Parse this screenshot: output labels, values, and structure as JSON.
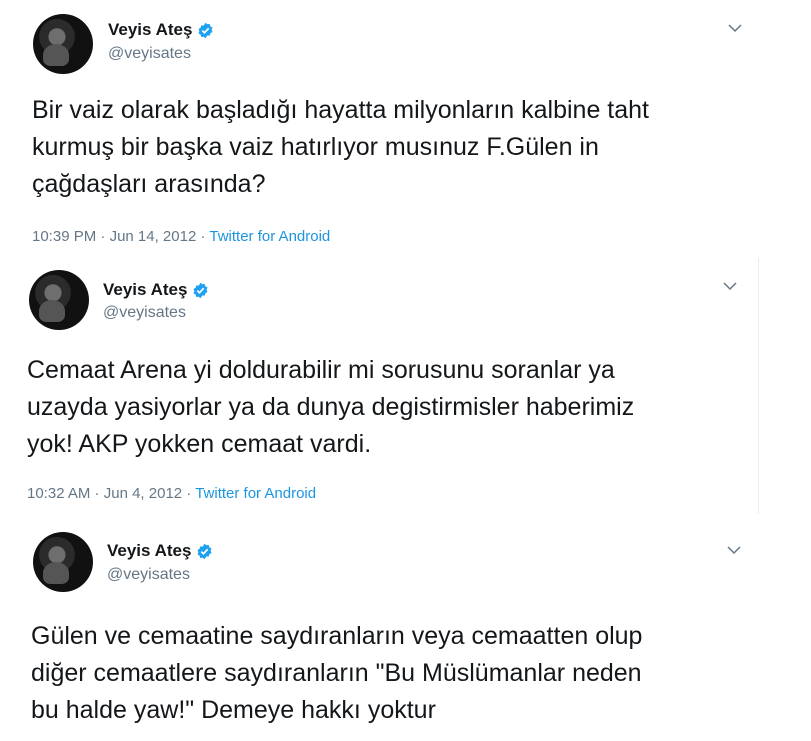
{
  "tweets": [
    {
      "author_name": "Veyis Ateş",
      "author_handle": "@veyisates",
      "verified_icon": "verified-badge-icon",
      "text": "Bir vaiz olarak başladığı hayatta milyonların kalbine taht\nkurmuş bir başka vaiz hatırlıyor musınuz F.Gülen in\nçağdaşları arasında?",
      "time": "10:39 PM",
      "date": "Jun 14, 2012",
      "source": "Twitter for Android"
    },
    {
      "author_name": "Veyis Ateş",
      "author_handle": "@veyisates",
      "verified_icon": "verified-badge-icon",
      "text": "Cemaat Arena yi doldurabilir mi sorusunu soranlar ya\nuzayda yasiyorlar ya da  dunya degistirmisler haberimiz\nyok! AKP yokken cemaat vardi.",
      "time": "10:32 AM",
      "date": "Jun 4, 2012",
      "source": "Twitter for Android"
    },
    {
      "author_name": "Veyis Ateş",
      "author_handle": "@veyisates",
      "verified_icon": "verified-badge-icon",
      "text": "Gülen ve cemaatine saydıranların veya cemaatten olup\ndiğer cemaatlere saydıranların \"Bu Müslümanlar neden\nbu halde yaw!\" Demeye hakkı yoktur"
    }
  ],
  "separator": " · ",
  "colors": {
    "text": "#14171a",
    "secondary": "#657786",
    "link": "#1b95e0",
    "verified": "#1da1f2"
  }
}
